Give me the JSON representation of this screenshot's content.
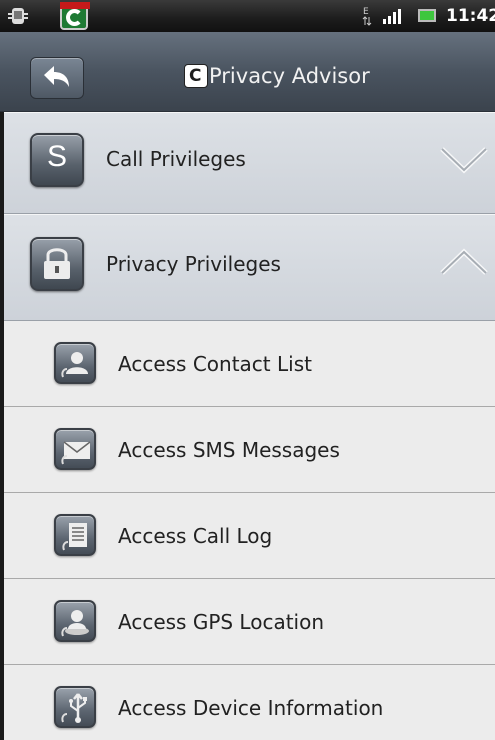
{
  "status_bar": {
    "time": "11:42",
    "data_indicator": "E"
  },
  "header": {
    "title": "Privacy Advisor",
    "logo_letter": "C"
  },
  "groups": [
    {
      "label": "Call Privileges",
      "icon_letter": "S",
      "expanded": false
    },
    {
      "label": "Privacy Privileges",
      "expanded": true
    }
  ],
  "items": [
    {
      "label": "Access Contact List",
      "icon": "contact-icon"
    },
    {
      "label": "Access SMS Messages",
      "icon": "envelope-icon"
    },
    {
      "label": "Access Call Log",
      "icon": "call-log-icon"
    },
    {
      "label": "Access GPS Location",
      "icon": "gps-location-icon"
    },
    {
      "label": "Access Device Information",
      "icon": "usb-device-icon"
    }
  ]
}
